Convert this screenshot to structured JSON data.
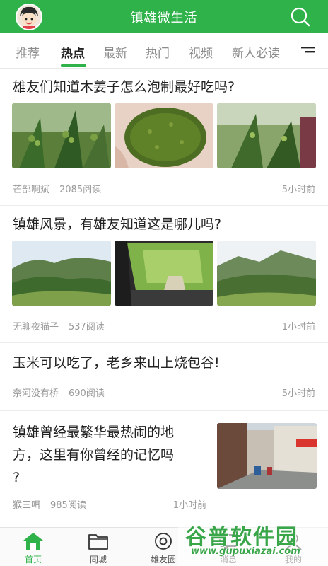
{
  "header": {
    "title": "镇雄微生活"
  },
  "tabs": [
    {
      "label": "推荐"
    },
    {
      "label": "热点"
    },
    {
      "label": "最新"
    },
    {
      "label": "热门"
    },
    {
      "label": "视频"
    },
    {
      "label": "新人必读"
    }
  ],
  "active_tab": "热点",
  "articles": [
    {
      "title": "雄友们知道木姜子怎么泡制最好吃吗?",
      "author": "芒部啊斌",
      "views": "2085阅读",
      "time": "5小时前"
    },
    {
      "title": "镇雄风景，有雄友知道这是哪儿吗?",
      "author": "无聊夜猫子",
      "views": "537阅读",
      "time": "1小时前"
    },
    {
      "title": "玉米可以吃了，老乡来山上烧包谷!",
      "author": "奈河没有桥",
      "views": "690阅读",
      "time": "5小时前"
    },
    {
      "title_line1": "镇雄曾经最繁华最热闹的地",
      "title_line2": "方，这里有你曾经的记忆吗",
      "title_line3": "?",
      "author": "猴三咡",
      "views": "985阅读",
      "time": "1小时前"
    }
  ],
  "bottom_nav": [
    {
      "label": "首页"
    },
    {
      "label": "同城"
    },
    {
      "label": "雄友圈"
    },
    {
      "label": "消息"
    },
    {
      "label": "我的"
    }
  ],
  "watermark": {
    "text": "谷普软件园",
    "url": "www.gupuxiazai.com"
  },
  "colors": {
    "brand": "#2fb24a",
    "meta_text": "#9a9a9a"
  }
}
